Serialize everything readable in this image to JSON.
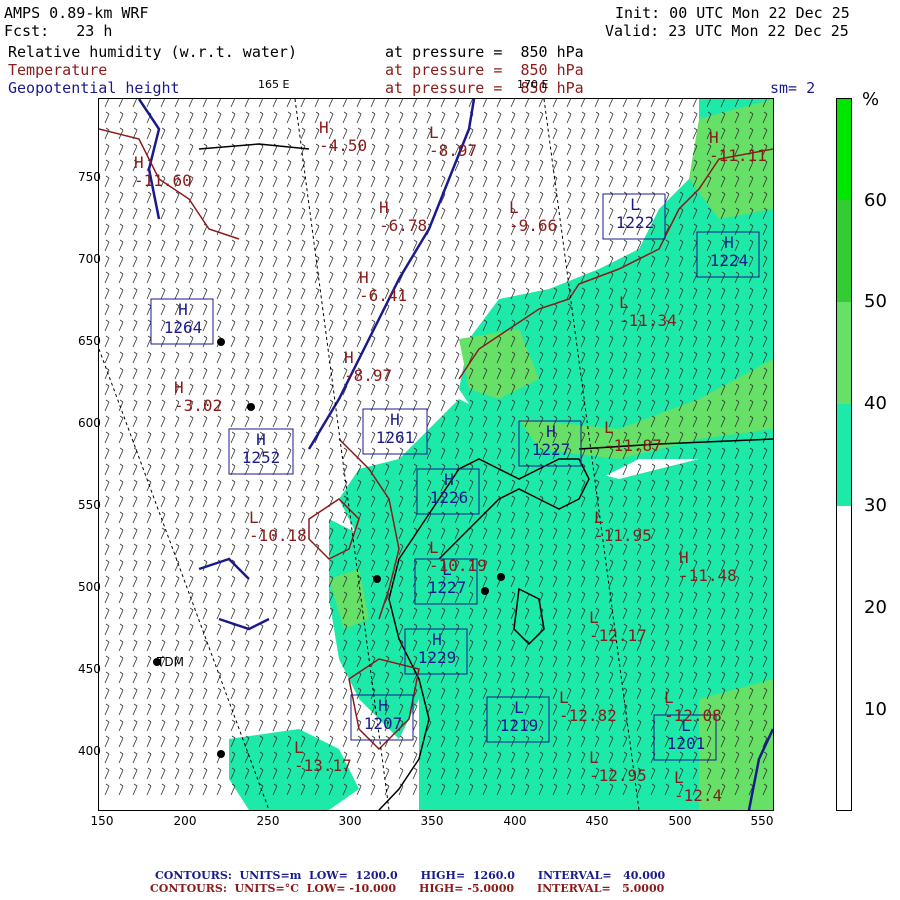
{
  "header": {
    "model": "AMPS 0.89-km WRF",
    "fcst": "Fcst:   23 h",
    "init": "Init: 00 UTC Mon 22 Dec 25",
    "valid": "Valid: 23 UTC Mon 22 Dec 25",
    "field1_name": "Relative humidity (w.r.t. water)",
    "field1_level": "at pressure =  850 hPa",
    "field2_name": "Temperature",
    "field2_level": "at pressure =  850 hPa",
    "field3_name": "Geopotential height",
    "field3_level": "at pressure =  850 hPa",
    "smoothing": "sm= 2",
    "lon_label_1": "165 E",
    "lon_label_2": "170 E"
  },
  "colorbar": {
    "unit": "%",
    "levels": [
      "60",
      "50",
      "40",
      "30",
      "20",
      "10"
    ],
    "colors": [
      "#00e600",
      "#33cc33",
      "#66e066",
      "#1de9a9",
      "#ffffff",
      "#ffffff",
      "#ffffff"
    ]
  },
  "axes": {
    "x_ticks": [
      "150",
      "200",
      "250",
      "300",
      "350",
      "400",
      "450",
      "500",
      "550"
    ],
    "y_ticks": [
      "750",
      "700",
      "650",
      "600",
      "550",
      "500",
      "450",
      "400"
    ]
  },
  "stations": {
    "tdm": "TDM"
  },
  "height_labels": [
    {
      "type": "H",
      "value": "1252"
    },
    {
      "type": "H",
      "value": "1261"
    },
    {
      "type": "L",
      "value": "1222"
    },
    {
      "type": "H",
      "value": "1224"
    },
    {
      "type": "H",
      "value": "1264"
    },
    {
      "type": "H",
      "value": "1227"
    },
    {
      "type": "H",
      "value": "1226"
    },
    {
      "type": "L",
      "value": "1227"
    },
    {
      "type": "H",
      "value": "1229"
    },
    {
      "type": "H",
      "value": "1207"
    },
    {
      "type": "L",
      "value": "1201"
    },
    {
      "type": "L",
      "value": "1219"
    }
  ],
  "temp_labels": [
    {
      "type": "H",
      "value": "-4.50"
    },
    {
      "type": "L",
      "value": "-8.97"
    },
    {
      "type": "H",
      "value": "-6.78"
    },
    {
      "type": "L",
      "value": "-9.66"
    },
    {
      "type": "L",
      "value": "-11.34"
    },
    {
      "type": "H",
      "value": "-6.41"
    },
    {
      "type": "H",
      "value": "-8.97"
    },
    {
      "type": "H",
      "value": "-3.02"
    },
    {
      "type": "L",
      "value": "-10.18"
    },
    {
      "type": "L",
      "value": "-10.19"
    },
    {
      "type": "H",
      "value": "-11.48"
    },
    {
      "type": "L",
      "value": "-12.17"
    },
    {
      "type": "L",
      "value": "-12.95"
    },
    {
      "type": "L",
      "value": "-12.4"
    },
    {
      "type": "L",
      "value": "-13.17"
    },
    {
      "type": "L",
      "value": "-11.95"
    },
    {
      "type": "L",
      "value": "-12.08"
    },
    {
      "type": "H",
      "value": "-11.60"
    },
    {
      "type": "L",
      "value": "-12.82"
    },
    {
      "type": "L",
      "value": "-11.87"
    },
    {
      "type": "H",
      "value": "-11.11"
    }
  ],
  "footer": {
    "line1": "CONTOURS:  UNITS=m  LOW=  1200.0      HIGH=  1260.0      INTERVAL=   40.000",
    "line2": "CONTOURS:  UNITS=°C  LOW= -10.000      HIGH= -5.0000      INTERVAL=   5.0000"
  },
  "colors": {
    "temperature": "#8b1a1a",
    "height": "#1a1a8c",
    "rh30": "#1de9a9",
    "rh40": "#66e066",
    "rh50": "#33cc33",
    "rh60": "#00e600"
  }
}
